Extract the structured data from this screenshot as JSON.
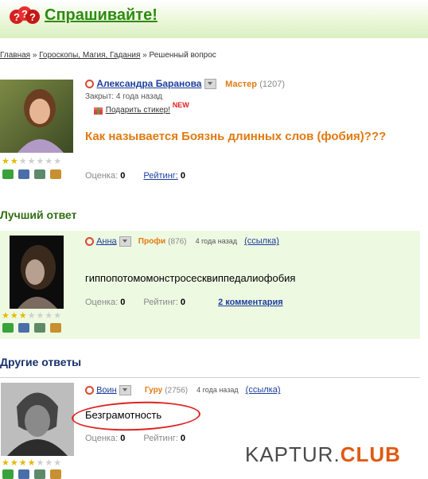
{
  "header": {
    "logo_mark": "???",
    "site_name": "Спрашивайте!"
  },
  "breadcrumb": {
    "home": "Главная",
    "sep1": "»",
    "category": "Гороскопы, Магия, Гадания",
    "sep2": "»",
    "current": "Решенный вопрос"
  },
  "question": {
    "author": "Александра Баранова",
    "rank": "Мастер",
    "rank_points": "(1207)",
    "closed": "Закрыт: 4 года назад",
    "gift_sticker": "Подарить стикер!",
    "new_badge": "NEW",
    "title": "Как называется Боязнь длинных слов (фобия)???",
    "score_label": "Оценка:",
    "score_value": "0",
    "rating_label": "Рейтинг:",
    "rating_value": "0",
    "stars_filled": 2
  },
  "best_answer": {
    "heading": "Лучший ответ",
    "author": "Анна",
    "rank": "Профи",
    "rank_points": "(876)",
    "time": "4 года назад",
    "link": "(ссылка)",
    "text": "гиппопотомомонстросесквиппедалиофобия",
    "score_label": "Оценка:",
    "score_value": "0",
    "rating_label": "Рейтинг:",
    "rating_value": "0",
    "comments": "2 комментария",
    "stars_filled": 3
  },
  "other_answers": {
    "heading": "Другие ответы",
    "items": [
      {
        "author": "Воин",
        "rank": "Гуру",
        "rank_points": "(2756)",
        "time": "4 года назад",
        "link": "(ссылка)",
        "text": "Безграмотность",
        "score_label": "Оценка:",
        "score_value": "0",
        "rating_label": "Рейтинг:",
        "rating_value": "0"
      }
    ]
  },
  "watermark": {
    "main": "KAPTUR.",
    "accent": "CLUB"
  },
  "colors": {
    "brand_green": "#2f8a13",
    "rank_orange": "#e07a10",
    "link_blue": "#1d3f9c",
    "best_bg": "#eef9e2",
    "annotation_red": "#dd2222"
  },
  "icons": [
    "question-marks-logo-icon",
    "dropdown-icon",
    "gift-icon",
    "user-group-icon",
    "camera-icon",
    "video-icon",
    "edit-icon",
    "star-icon"
  ]
}
